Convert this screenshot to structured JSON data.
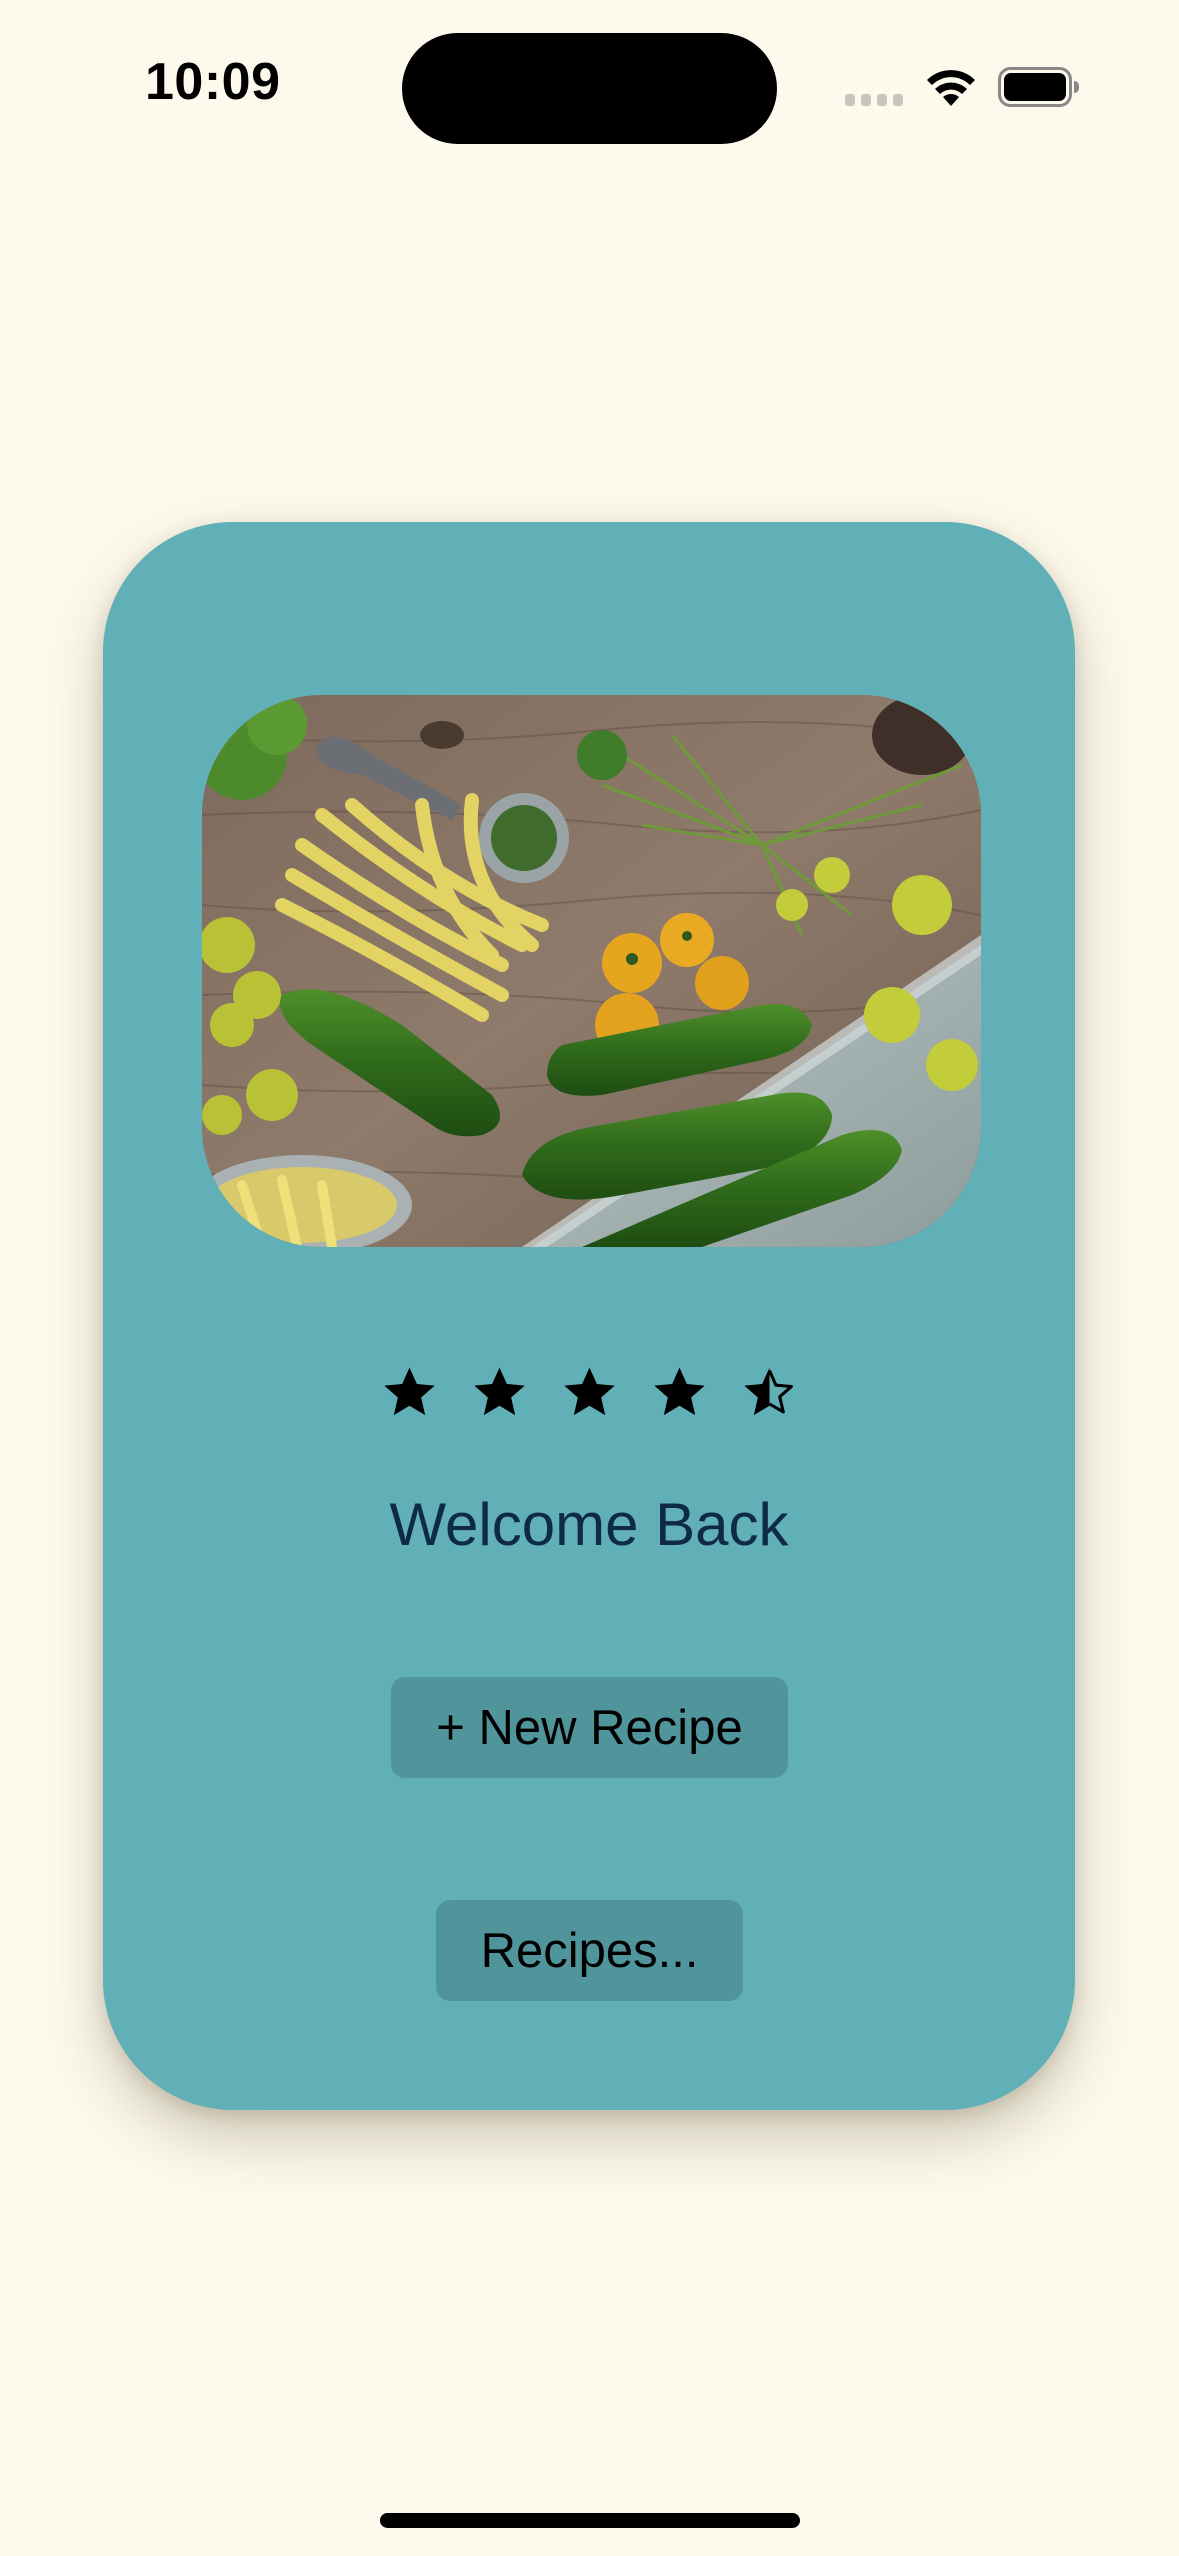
{
  "status_bar": {
    "time": "10:09"
  },
  "card": {
    "rating": {
      "value": 4.5,
      "max": 5
    },
    "welcome_text": "Welcome Back",
    "new_recipe_label": "+ New Recipe",
    "recipes_label": "Recipes..."
  },
  "colors": {
    "background": "#fdf9ec",
    "card": "#61afb7",
    "button": "#4f959b",
    "welcome_text": "#0f2a44"
  }
}
